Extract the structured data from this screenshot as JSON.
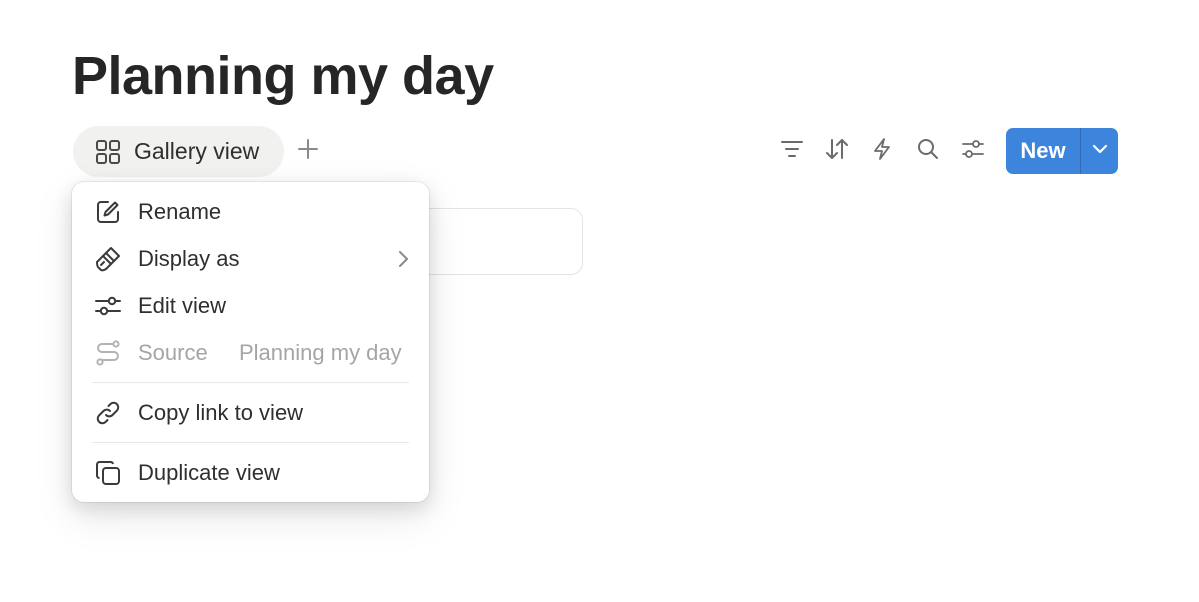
{
  "page": {
    "title": "Planning my day"
  },
  "views": {
    "active_tab": {
      "label": "Gallery view",
      "icon": "gallery-grid-icon"
    },
    "add_view_icon": "plus-icon"
  },
  "toolbar": {
    "icons": [
      "filter-icon",
      "sort-icon",
      "automation-lightning-icon",
      "search-icon",
      "settings-sliders-icon"
    ],
    "new_button": {
      "label": "New",
      "caret_icon": "chevron-down-icon"
    },
    "accent_color": "#3d84dc"
  },
  "menu": {
    "rename": {
      "label": "Rename",
      "icon": "edit-pencil-icon"
    },
    "display_as": {
      "label": "Display as",
      "icon": "paint-brush-icon",
      "submenu_icon": "chevron-right-icon"
    },
    "edit_view": {
      "label": "Edit view",
      "icon": "sliders-icon"
    },
    "source": {
      "label": "Source",
      "value": "Planning my day",
      "icon": "source-route-icon",
      "disabled": true
    },
    "copy_link": {
      "label": "Copy link to view",
      "icon": "link-icon"
    },
    "duplicate": {
      "label": "Duplicate view",
      "icon": "duplicate-icon"
    }
  }
}
